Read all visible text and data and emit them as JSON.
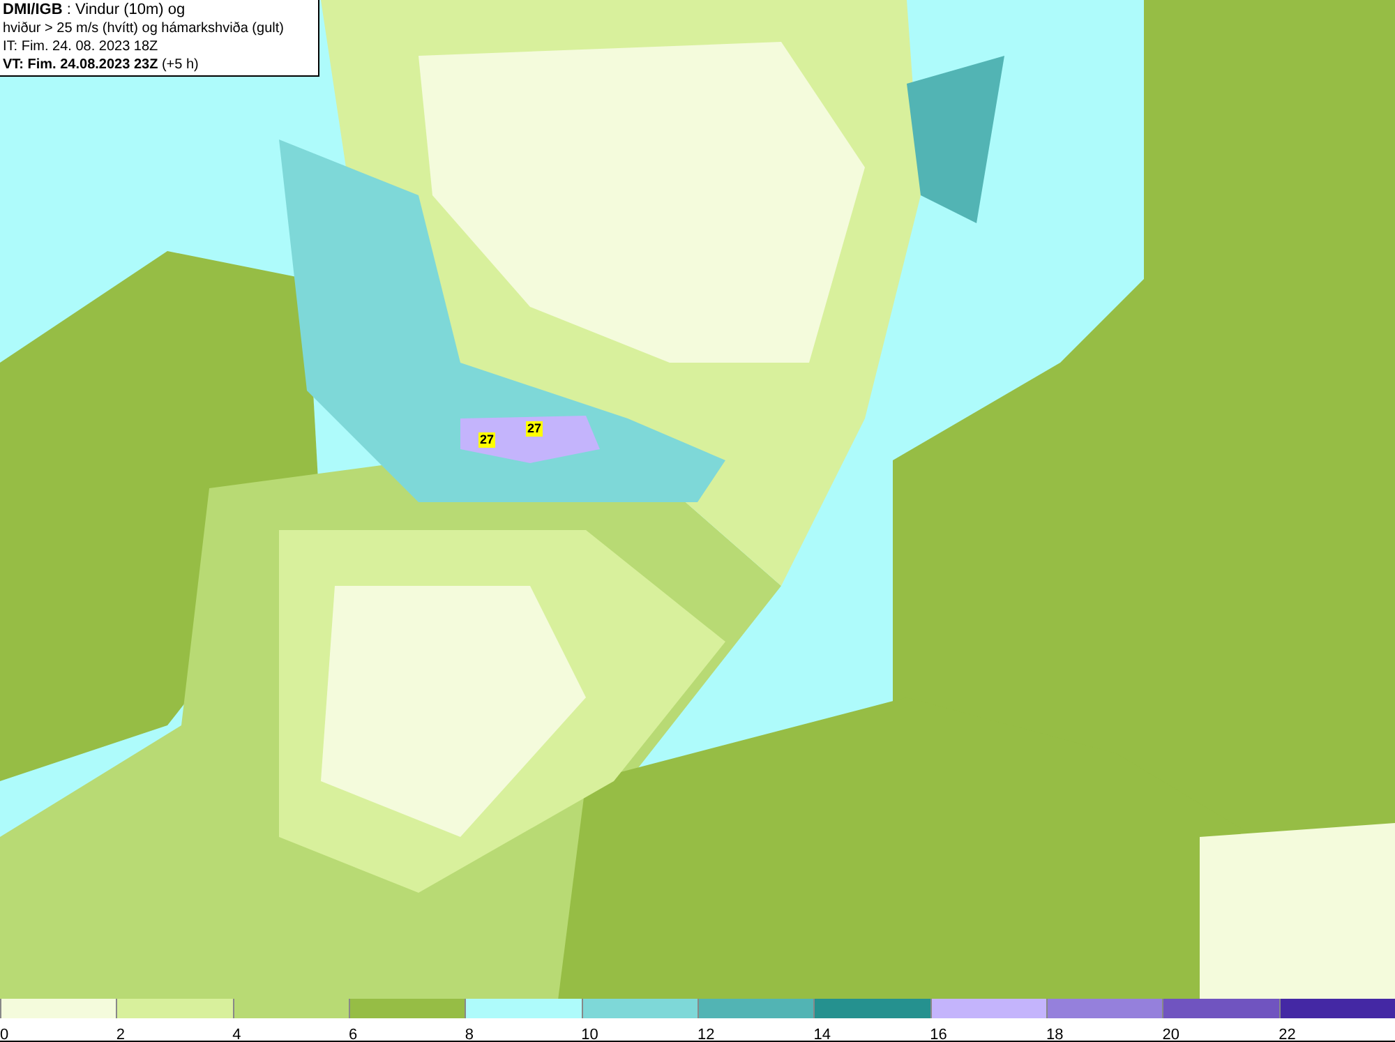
{
  "info_box": {
    "lines": [
      "**DMI/IGB** : Vindur (10m) og",
      "hviður > 25 m/s (hvítt) og hámarkshviða (gult)",
      "IT: Fim. 24. 08. 2023 18Z",
      "**VT: Fim. 24.08.2023 23Z** (+5 h)"
    ]
  },
  "gust_labels": [
    {
      "text": "27"
    },
    {
      "text": "27"
    }
  ],
  "legend": {
    "bins": [
      {
        "color": "#f4fbdc",
        "label": "0"
      },
      {
        "color": "#d8f09c",
        "label": "2"
      },
      {
        "color": "#b8da74",
        "label": "4"
      },
      {
        "color": "#96bd45",
        "label": "6"
      },
      {
        "color": "#aefbfb",
        "label": "8"
      },
      {
        "color": "#7ed8d8",
        "label": "10"
      },
      {
        "color": "#52b4b4",
        "label": "12"
      },
      {
        "color": "#25918f",
        "label": "14"
      },
      {
        "color": "#c4b4fc",
        "label": "16"
      },
      {
        "color": "#9580dc",
        "label": "18"
      },
      {
        "color": "#7054c0",
        "label": "20"
      },
      {
        "color": "#4428a4",
        "label": "22"
      }
    ]
  }
}
